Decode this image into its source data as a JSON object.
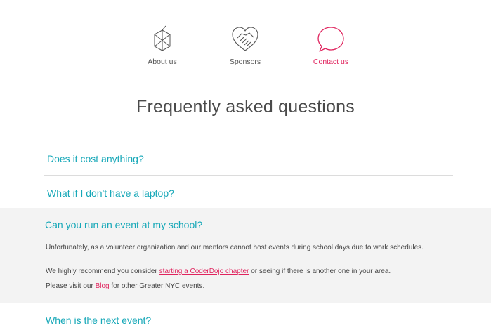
{
  "nav": {
    "items": [
      {
        "label": "About us",
        "icon": "cube-icon"
      },
      {
        "label": "Sponsors",
        "icon": "handshake-heart-icon"
      },
      {
        "label": "Contact us",
        "icon": "speech-bubble-icon"
      }
    ],
    "active_color": "#e0245e"
  },
  "page_title": "Frequently asked questions",
  "faq": {
    "q1": "Does it cost anything?",
    "q2": "What if I don't have a laptop?",
    "q3": "Can you run an event at my school?",
    "q3_answer": {
      "p1": "Unfortunately, as a volunteer organization and our mentors cannot host events during school days due to work schedules.",
      "p2_before": "We highly recommend you consider ",
      "p2_link": "starting a CoderDojo chapter",
      "p2_after": " or seeing if there is another one in your area.",
      "p3_before": "Please visit our ",
      "p3_link": "Blog",
      "p3_after": " for other Greater NYC events."
    },
    "q4": "When is the next event?"
  },
  "colors": {
    "question": "#17a8b8",
    "link": "#e0245e",
    "open_bg": "#f3f3f3"
  }
}
